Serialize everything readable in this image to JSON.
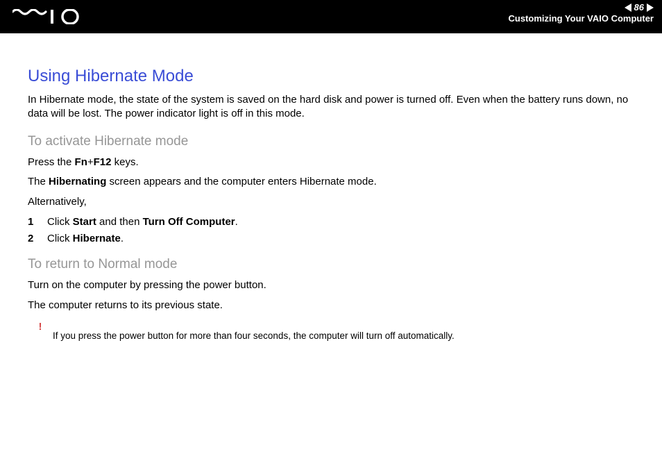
{
  "header": {
    "page_number": "86",
    "section": "Customizing Your VAIO Computer"
  },
  "title": "Using Hibernate Mode",
  "intro": "In Hibernate mode, the state of the system is saved on the hard disk and power is turned off. Even when the battery runs down, no data will be lost. The power indicator light is off in this mode.",
  "activate": {
    "heading": "To activate Hibernate mode",
    "press_pre": "Press the ",
    "press_key1": "Fn",
    "press_plus": "+",
    "press_key2": "F12",
    "press_post": " keys.",
    "hib_pre": "The ",
    "hib_bold": "Hibernating",
    "hib_post": " screen appears and the computer enters Hibernate mode.",
    "alt": "Alternatively,",
    "step1_num": "1",
    "step1_pre": "Click ",
    "step1_b1": "Start",
    "step1_mid": " and then ",
    "step1_b2": "Turn Off Computer",
    "step1_post": ".",
    "step2_num": "2",
    "step2_pre": "Click ",
    "step2_b1": "Hibernate",
    "step2_post": "."
  },
  "return": {
    "heading": "To return to Normal mode",
    "line1": "Turn on the computer by pressing the power button.",
    "line2": "The computer returns to its previous state."
  },
  "note": {
    "mark": "!",
    "text": "If you press the power button for more than four seconds, the computer will turn off automatically."
  }
}
